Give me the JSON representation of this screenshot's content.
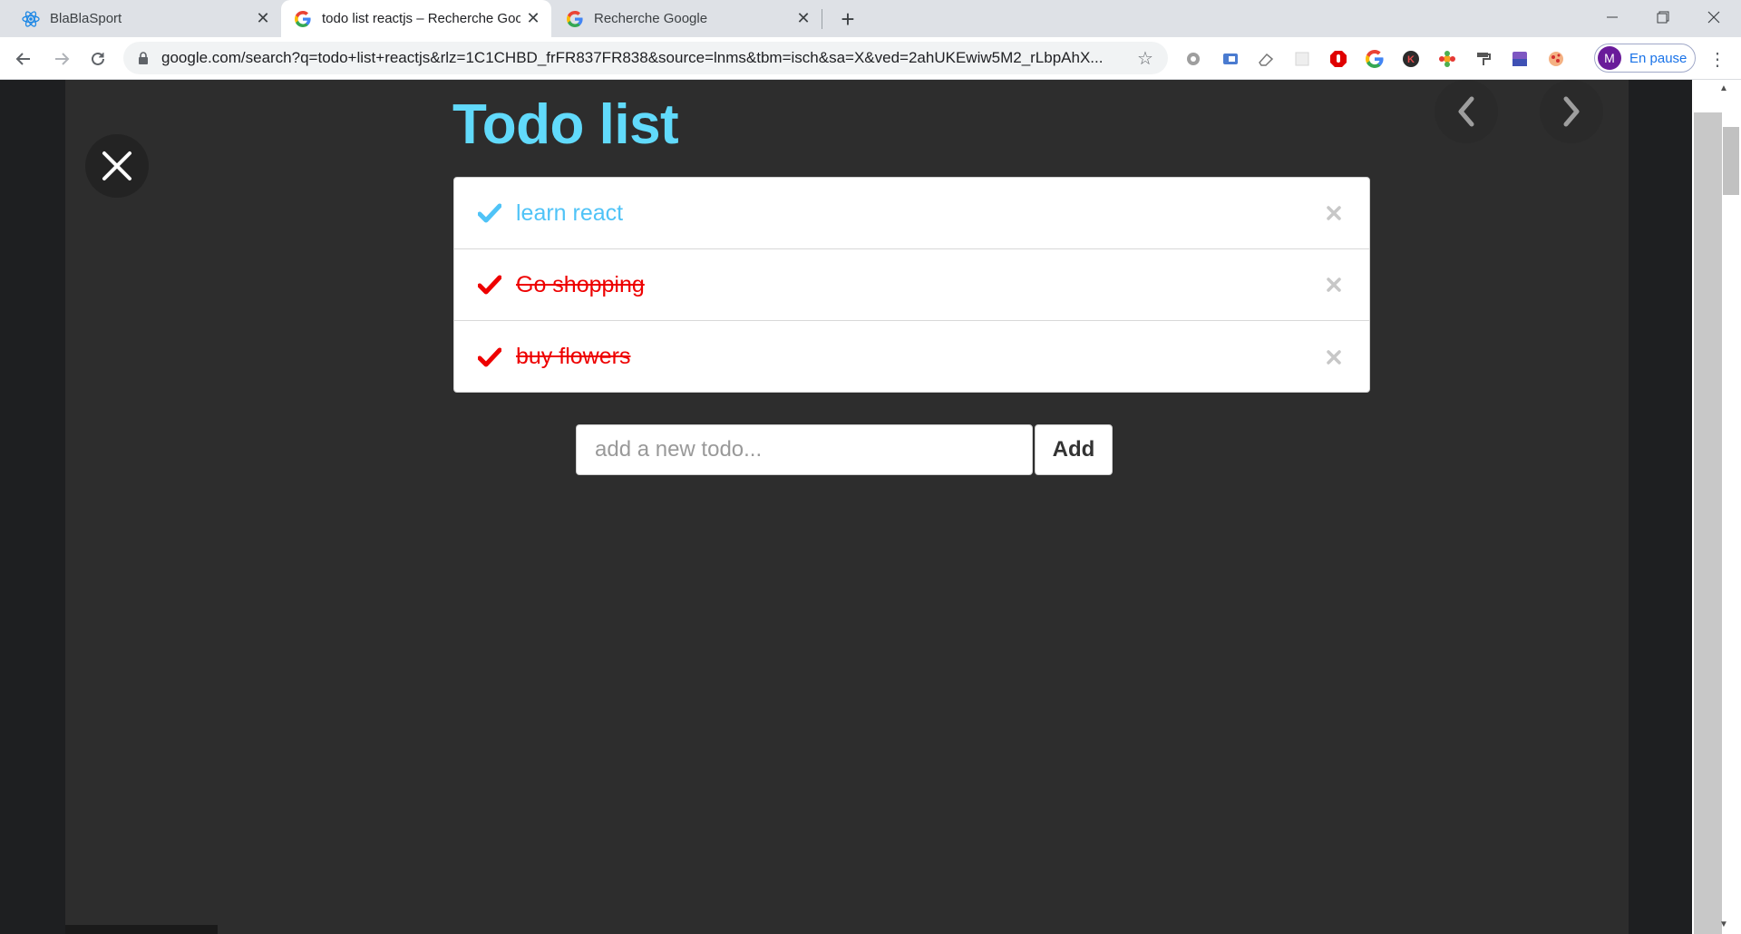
{
  "tabs": [
    {
      "title": "BlaBlaSport",
      "favicon": "react-icon",
      "active": false
    },
    {
      "title": "todo list reactjs – Recherche Goo",
      "favicon": "google-icon",
      "active": true
    },
    {
      "title": "Recherche Google",
      "favicon": "google-icon",
      "active": false
    }
  ],
  "toolbar": {
    "url": "google.com/search?q=todo+list+reactjs&rlz=1C1CHBD_frFR837FR838&source=lnms&tbm=isch&sa=X&ved=2ahUKEwiw5M2_rLbpAhX...",
    "profile_initial": "M",
    "profile_label": "En pause"
  },
  "extensions": [
    "gear-extension-icon",
    "translate-extension-icon",
    "eraser-extension-icon",
    "blank-extension-icon",
    "adblock-extension-icon",
    "google-extension-icon",
    "k-extension-icon",
    "flower-extension-icon",
    "paint-roller-extension-icon",
    "purple-square-extension-icon",
    "pizza-extension-icon"
  ],
  "colors": {
    "react_blue": "#61dafb",
    "done_red": "#ee0000",
    "pane_background": "#2d2d2d"
  },
  "todo": {
    "title": "Todo list",
    "items": [
      {
        "text": "learn react",
        "done": false
      },
      {
        "text": "Go shopping",
        "done": true
      },
      {
        "text": "buy flowers",
        "done": true
      }
    ],
    "input_placeholder": "add a new todo...",
    "input_value": "",
    "add_label": "Add"
  }
}
